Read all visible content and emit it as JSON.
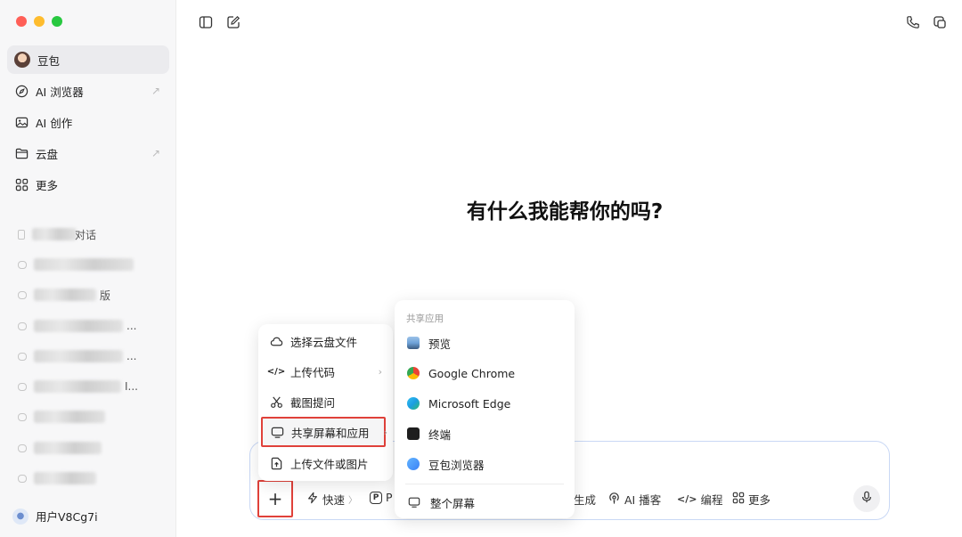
{
  "sidebar": {
    "nav": [
      {
        "label": "豆包",
        "icon": "avatar-icon"
      },
      {
        "label": "AI 浏览器",
        "icon": "compass-icon",
        "external": "↗"
      },
      {
        "label": "AI 创作",
        "icon": "image-icon"
      },
      {
        "label": "云盘",
        "icon": "folder-icon",
        "external": "↗"
      },
      {
        "label": "更多",
        "icon": "grid-icon"
      }
    ],
    "conversations": [
      {
        "visible_text": "对话"
      },
      {
        "visible_text": ""
      },
      {
        "visible_text": "版"
      },
      {
        "visible_text": "..."
      },
      {
        "visible_text": "..."
      },
      {
        "visible_text": "I..."
      },
      {
        "visible_text": ""
      },
      {
        "visible_text": ""
      },
      {
        "visible_text": ""
      }
    ],
    "user": "用户V8Cg7i"
  },
  "main": {
    "headline": "有什么我能帮你的吗?"
  },
  "composer": {
    "plus": "+",
    "tools": [
      {
        "label": "快速",
        "icon": "lightning-icon",
        "suffix": "〉"
      },
      {
        "label": "P",
        "icon": "p-icon"
      },
      {
        "label": "生成",
        "icon": ""
      },
      {
        "label": "AI 播客",
        "icon": "podcast-icon"
      },
      {
        "label": "编程",
        "icon": "code-icon"
      },
      {
        "label": "更多",
        "icon": "grid-icon"
      }
    ]
  },
  "menu": {
    "items": [
      {
        "label": "选择云盘文件",
        "icon": "cloud-icon"
      },
      {
        "label": "上传代码",
        "icon": "code-icon",
        "chevron": "›"
      },
      {
        "label": "截图提问",
        "icon": "scissors-icon"
      },
      {
        "label": "共享屏幕和应用",
        "icon": "monitor-icon",
        "chevron": "›"
      },
      {
        "label": "上传文件或图片",
        "icon": "upload-icon"
      }
    ]
  },
  "submenu": {
    "title": "共享应用",
    "apps": [
      {
        "label": "预览",
        "color": "#6fa3d8"
      },
      {
        "label": "Google Chrome",
        "color": "#ea4335"
      },
      {
        "label": "Microsoft Edge",
        "color": "#1b9de2"
      },
      {
        "label": "终端",
        "color": "#1e1e1e"
      },
      {
        "label": "豆包浏览器",
        "color": "#3b82f6"
      }
    ],
    "screen": "整个屏幕"
  },
  "colors": {
    "highlight_border": "#e0413a",
    "composer_border": "#c9d8f5"
  }
}
